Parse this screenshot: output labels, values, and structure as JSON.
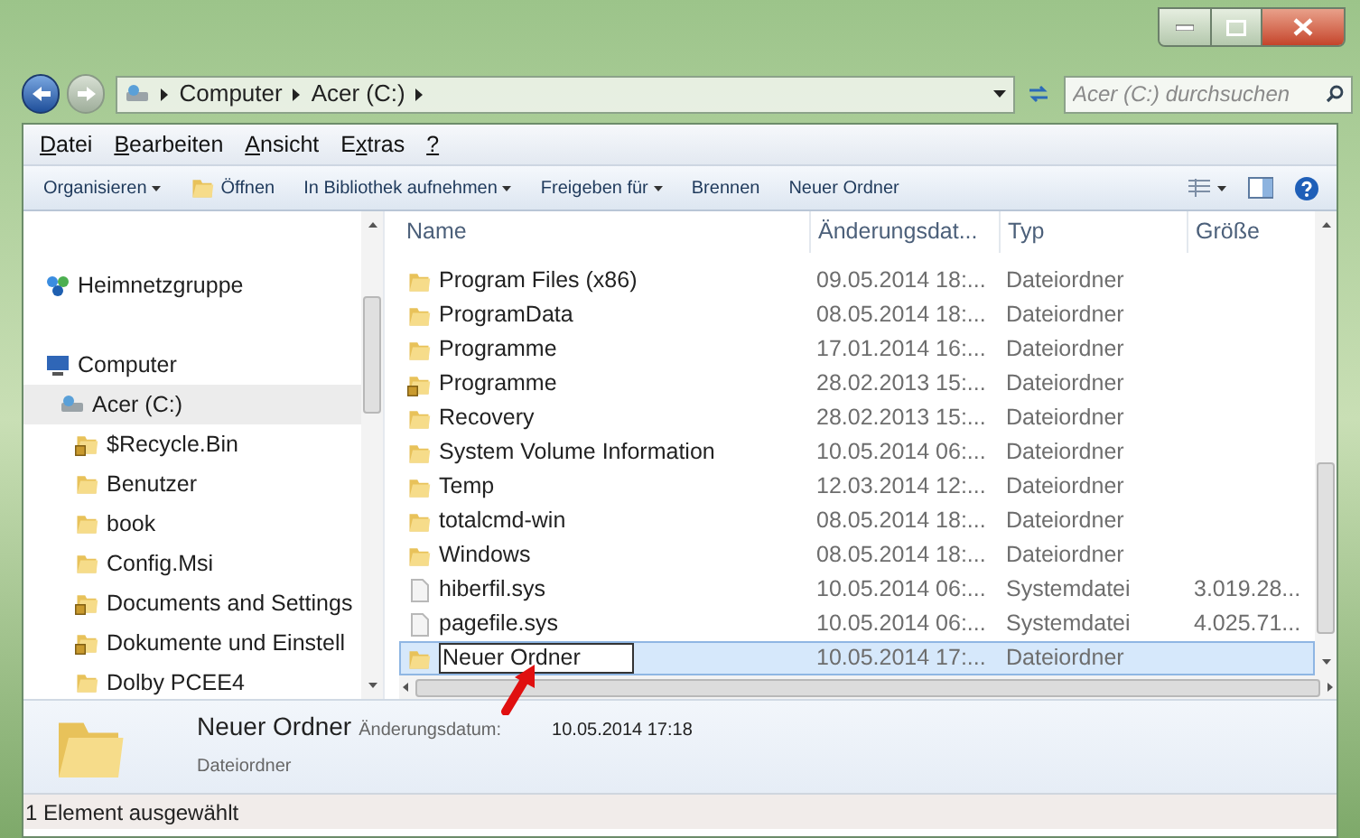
{
  "address": {
    "crumbs": [
      "Computer",
      "Acer (C:)"
    ],
    "search_placeholder": "Acer (C:) durchsuchen"
  },
  "menu": [
    {
      "key": "D",
      "post": "atei"
    },
    {
      "key": "B",
      "post": "earbeiten"
    },
    {
      "key": "A",
      "post": "nsicht"
    },
    {
      "pre": "E",
      "key": "x",
      "post": "tras"
    },
    {
      "key": "?"
    }
  ],
  "toolbar": [
    {
      "label": "Organisieren",
      "kind": "dropdown"
    },
    {
      "label": "Öffnen",
      "kind": "open"
    },
    {
      "label": "In Bibliothek aufnehmen",
      "kind": "dropdown"
    },
    {
      "label": "Freigeben für",
      "kind": "dropdown"
    },
    {
      "label": "Brennen",
      "kind": "plain"
    },
    {
      "label": "Neuer Ordner",
      "kind": "plain"
    }
  ],
  "nav": [
    {
      "label": "Heimnetzgruppe",
      "kind": "homegroup",
      "selected": false
    },
    {
      "label": "Computer",
      "kind": "computer",
      "selected": false,
      "children": [
        {
          "label": "Acer (C:)",
          "kind": "drive",
          "selected": true,
          "children": [
            {
              "label": "$Recycle.Bin",
              "kind": "folder",
              "locked": true,
              "selected": false
            },
            {
              "label": "Benutzer",
              "kind": "folder",
              "locked": false,
              "selected": false
            },
            {
              "label": "book",
              "kind": "folder",
              "locked": false,
              "selected": false
            },
            {
              "label": "Config.Msi",
              "kind": "folder",
              "locked": false,
              "selected": false
            },
            {
              "label": "Documents and Settings",
              "kind": "folder",
              "locked": true,
              "selected": false
            },
            {
              "label": "Dokumente und Einstell",
              "kind": "folder",
              "locked": true,
              "selected": false
            },
            {
              "label": "Dolby PCEE4",
              "kind": "folder",
              "locked": false,
              "selected": false
            }
          ]
        }
      ]
    }
  ],
  "columns": [
    "Name",
    "Änderungsdat...",
    "Typ",
    "Größe"
  ],
  "files": [
    {
      "kind": "folder",
      "name": "Program Files (x86)",
      "date": "09.05.2014 18:...",
      "type": "Dateiordner",
      "locked": false,
      "selected": false
    },
    {
      "kind": "folder",
      "name": "ProgramData",
      "date": "08.05.2014 18:...",
      "type": "Dateiordner",
      "locked": false,
      "selected": false
    },
    {
      "kind": "folder",
      "name": "Programme",
      "date": "17.01.2014 16:...",
      "type": "Dateiordner",
      "locked": false,
      "selected": false
    },
    {
      "kind": "folder",
      "name": "Programme",
      "date": "28.02.2013 15:...",
      "type": "Dateiordner",
      "locked": true,
      "selected": false
    },
    {
      "kind": "folder",
      "name": "Recovery",
      "date": "28.02.2013 15:...",
      "type": "Dateiordner",
      "locked": false,
      "selected": false
    },
    {
      "kind": "folder",
      "name": "System Volume Information",
      "date": "10.05.2014 06:...",
      "type": "Dateiordner",
      "locked": false,
      "selected": false
    },
    {
      "kind": "folder",
      "name": "Temp",
      "date": "12.03.2014 12:...",
      "type": "Dateiordner",
      "locked": false,
      "selected": false
    },
    {
      "kind": "folder",
      "name": "totalcmd-win",
      "date": "08.05.2014 18:...",
      "type": "Dateiordner",
      "locked": false,
      "selected": false
    },
    {
      "kind": "folder",
      "name": "Windows",
      "date": "08.05.2014 18:...",
      "type": "Dateiordner",
      "locked": false,
      "selected": false
    },
    {
      "kind": "file",
      "name": "hiberfil.sys",
      "date": "10.05.2014 06:...",
      "type": "Systemdatei",
      "size": "3.019.28...",
      "locked": false,
      "selected": false
    },
    {
      "kind": "file",
      "name": "pagefile.sys",
      "date": "10.05.2014 06:...",
      "type": "Systemdatei",
      "size": "4.025.71...",
      "locked": false,
      "selected": false
    },
    {
      "kind": "folder",
      "name": "Neuer Ordner",
      "date": "10.05.2014 17:...",
      "type": "Dateiordner",
      "locked": false,
      "selected": true,
      "editing": true
    }
  ],
  "details": {
    "name": "Neuer Ordner",
    "date_label": "Änderungsdatum:",
    "date": "10.05.2014 17:18",
    "type": "Dateiordner"
  },
  "status": "1 Element ausgewählt"
}
